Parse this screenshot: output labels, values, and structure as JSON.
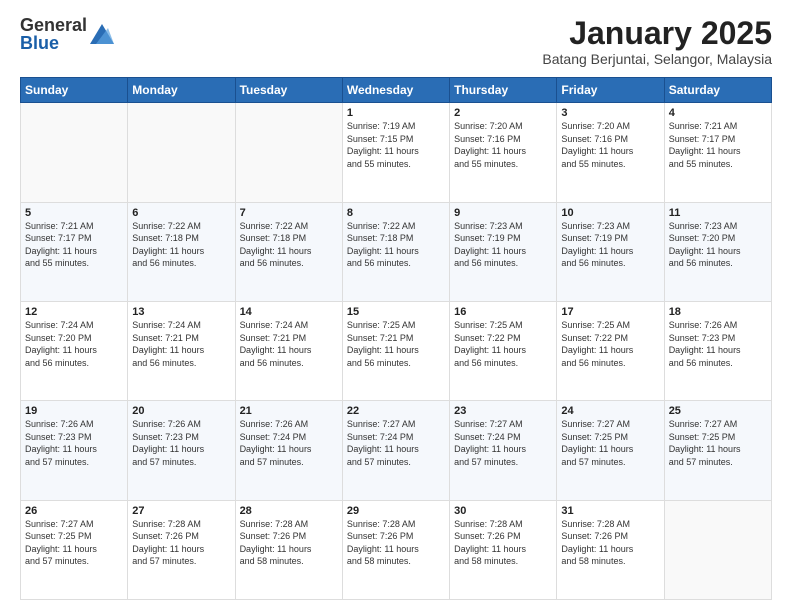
{
  "logo": {
    "general": "General",
    "blue": "Blue"
  },
  "header": {
    "month": "January 2025",
    "location": "Batang Berjuntai, Selangor, Malaysia"
  },
  "weekdays": [
    "Sunday",
    "Monday",
    "Tuesday",
    "Wednesday",
    "Thursday",
    "Friday",
    "Saturday"
  ],
  "weeks": [
    [
      {
        "day": "",
        "info": ""
      },
      {
        "day": "",
        "info": ""
      },
      {
        "day": "",
        "info": ""
      },
      {
        "day": "1",
        "info": "Sunrise: 7:19 AM\nSunset: 7:15 PM\nDaylight: 11 hours\nand 55 minutes."
      },
      {
        "day": "2",
        "info": "Sunrise: 7:20 AM\nSunset: 7:16 PM\nDaylight: 11 hours\nand 55 minutes."
      },
      {
        "day": "3",
        "info": "Sunrise: 7:20 AM\nSunset: 7:16 PM\nDaylight: 11 hours\nand 55 minutes."
      },
      {
        "day": "4",
        "info": "Sunrise: 7:21 AM\nSunset: 7:17 PM\nDaylight: 11 hours\nand 55 minutes."
      }
    ],
    [
      {
        "day": "5",
        "info": "Sunrise: 7:21 AM\nSunset: 7:17 PM\nDaylight: 11 hours\nand 55 minutes."
      },
      {
        "day": "6",
        "info": "Sunrise: 7:22 AM\nSunset: 7:18 PM\nDaylight: 11 hours\nand 56 minutes."
      },
      {
        "day": "7",
        "info": "Sunrise: 7:22 AM\nSunset: 7:18 PM\nDaylight: 11 hours\nand 56 minutes."
      },
      {
        "day": "8",
        "info": "Sunrise: 7:22 AM\nSunset: 7:18 PM\nDaylight: 11 hours\nand 56 minutes."
      },
      {
        "day": "9",
        "info": "Sunrise: 7:23 AM\nSunset: 7:19 PM\nDaylight: 11 hours\nand 56 minutes."
      },
      {
        "day": "10",
        "info": "Sunrise: 7:23 AM\nSunset: 7:19 PM\nDaylight: 11 hours\nand 56 minutes."
      },
      {
        "day": "11",
        "info": "Sunrise: 7:23 AM\nSunset: 7:20 PM\nDaylight: 11 hours\nand 56 minutes."
      }
    ],
    [
      {
        "day": "12",
        "info": "Sunrise: 7:24 AM\nSunset: 7:20 PM\nDaylight: 11 hours\nand 56 minutes."
      },
      {
        "day": "13",
        "info": "Sunrise: 7:24 AM\nSunset: 7:21 PM\nDaylight: 11 hours\nand 56 minutes."
      },
      {
        "day": "14",
        "info": "Sunrise: 7:24 AM\nSunset: 7:21 PM\nDaylight: 11 hours\nand 56 minutes."
      },
      {
        "day": "15",
        "info": "Sunrise: 7:25 AM\nSunset: 7:21 PM\nDaylight: 11 hours\nand 56 minutes."
      },
      {
        "day": "16",
        "info": "Sunrise: 7:25 AM\nSunset: 7:22 PM\nDaylight: 11 hours\nand 56 minutes."
      },
      {
        "day": "17",
        "info": "Sunrise: 7:25 AM\nSunset: 7:22 PM\nDaylight: 11 hours\nand 56 minutes."
      },
      {
        "day": "18",
        "info": "Sunrise: 7:26 AM\nSunset: 7:23 PM\nDaylight: 11 hours\nand 56 minutes."
      }
    ],
    [
      {
        "day": "19",
        "info": "Sunrise: 7:26 AM\nSunset: 7:23 PM\nDaylight: 11 hours\nand 57 minutes."
      },
      {
        "day": "20",
        "info": "Sunrise: 7:26 AM\nSunset: 7:23 PM\nDaylight: 11 hours\nand 57 minutes."
      },
      {
        "day": "21",
        "info": "Sunrise: 7:26 AM\nSunset: 7:24 PM\nDaylight: 11 hours\nand 57 minutes."
      },
      {
        "day": "22",
        "info": "Sunrise: 7:27 AM\nSunset: 7:24 PM\nDaylight: 11 hours\nand 57 minutes."
      },
      {
        "day": "23",
        "info": "Sunrise: 7:27 AM\nSunset: 7:24 PM\nDaylight: 11 hours\nand 57 minutes."
      },
      {
        "day": "24",
        "info": "Sunrise: 7:27 AM\nSunset: 7:25 PM\nDaylight: 11 hours\nand 57 minutes."
      },
      {
        "day": "25",
        "info": "Sunrise: 7:27 AM\nSunset: 7:25 PM\nDaylight: 11 hours\nand 57 minutes."
      }
    ],
    [
      {
        "day": "26",
        "info": "Sunrise: 7:27 AM\nSunset: 7:25 PM\nDaylight: 11 hours\nand 57 minutes."
      },
      {
        "day": "27",
        "info": "Sunrise: 7:28 AM\nSunset: 7:26 PM\nDaylight: 11 hours\nand 57 minutes."
      },
      {
        "day": "28",
        "info": "Sunrise: 7:28 AM\nSunset: 7:26 PM\nDaylight: 11 hours\nand 58 minutes."
      },
      {
        "day": "29",
        "info": "Sunrise: 7:28 AM\nSunset: 7:26 PM\nDaylight: 11 hours\nand 58 minutes."
      },
      {
        "day": "30",
        "info": "Sunrise: 7:28 AM\nSunset: 7:26 PM\nDaylight: 11 hours\nand 58 minutes."
      },
      {
        "day": "31",
        "info": "Sunrise: 7:28 AM\nSunset: 7:26 PM\nDaylight: 11 hours\nand 58 minutes."
      },
      {
        "day": "",
        "info": ""
      }
    ]
  ]
}
